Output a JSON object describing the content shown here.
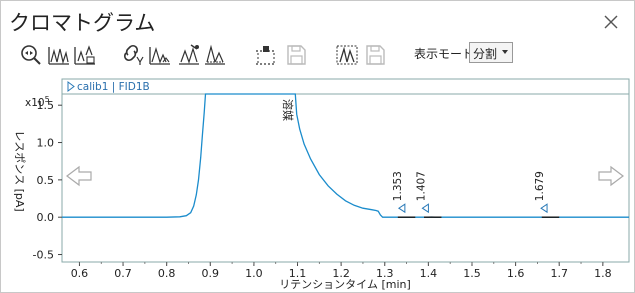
{
  "window": {
    "title": "クロマトグラム"
  },
  "toolbar": {
    "mode_label": "表示モード",
    "mode_value": "分割",
    "icons": [
      "zoom-icon",
      "overlay-peaks-icon",
      "stack-peaks-icon",
      "link-icon",
      "integrate-icon",
      "manual-integrate-icon",
      "baseline-icon",
      "tick-marks-icon",
      "save-icon",
      "peak-window-icon",
      "save-icon"
    ]
  },
  "chart_data": {
    "type": "line",
    "trace_label": "calib1 | FID1B",
    "multiplier": "x10",
    "multiplier_exp": "5",
    "xlabel": "リテンションタイム [min]",
    "ylabel": "レスポンス [pA]",
    "xlim": [
      0.56,
      1.86
    ],
    "ylim": [
      -0.6,
      1.65
    ],
    "xticks": [
      "0.6",
      "0.7",
      "0.8",
      "0.9",
      "1.0",
      "1.1",
      "1.2",
      "1.3",
      "1.4",
      "1.5",
      "1.6",
      "1.7",
      "1.8"
    ],
    "yticks": [
      "-0.5",
      "0.0",
      "0.5",
      "1.0",
      "1.5"
    ],
    "solvent_label": "溶媒",
    "series": [
      {
        "x": [
          0.56,
          0.8,
          0.83,
          0.845,
          0.855,
          0.862,
          0.868,
          0.873,
          0.878,
          0.882,
          0.886,
          0.889,
          0.892,
          1.095,
          1.098,
          1.105,
          1.115,
          1.13,
          1.15,
          1.17,
          1.19,
          1.21,
          1.23,
          1.25,
          1.27,
          1.28,
          1.285,
          1.29,
          1.295,
          1.34,
          1.353,
          1.36,
          1.4,
          1.407,
          1.415,
          1.5,
          1.66,
          1.679,
          1.69,
          1.86
        ],
        "y": [
          0.0,
          0.0,
          0.005,
          0.02,
          0.06,
          0.15,
          0.3,
          0.5,
          0.8,
          1.1,
          1.4,
          1.65,
          1.65,
          1.65,
          1.38,
          1.18,
          0.98,
          0.78,
          0.57,
          0.42,
          0.31,
          0.22,
          0.16,
          0.12,
          0.1,
          0.09,
          0.08,
          0.03,
          0.0,
          0.0,
          0.002,
          0.0,
          0.0,
          0.003,
          0.0,
          0.0,
          0.0,
          0.002,
          0.0,
          0.0
        ]
      }
    ],
    "peaks": [
      {
        "label": "1.353",
        "x": 1.353
      },
      {
        "label": "1.407",
        "x": 1.407
      },
      {
        "label": "1.679",
        "x": 1.679
      }
    ],
    "line_color": "#1b8ccc"
  }
}
